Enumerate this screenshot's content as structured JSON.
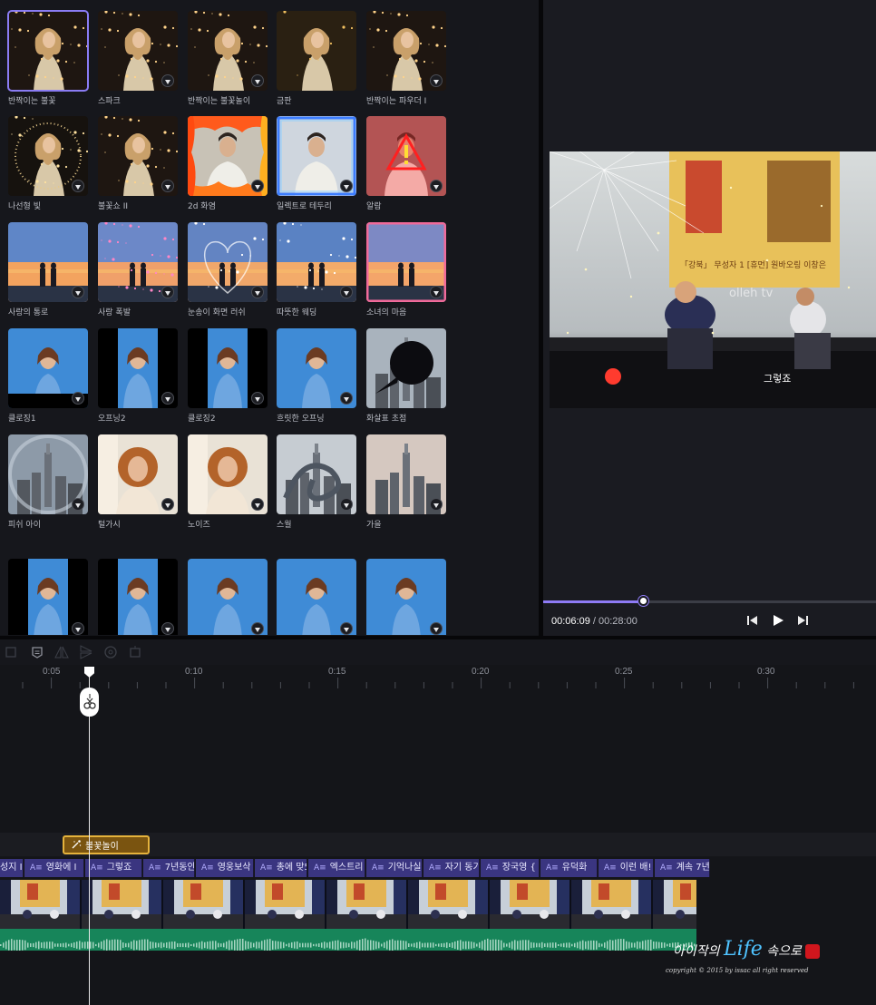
{
  "effects": {
    "rows": [
      [
        {
          "label": "반짝이는 불꽃",
          "selected": true,
          "download": false,
          "scene": "sparkle-woman"
        },
        {
          "label": "스파크",
          "download": true,
          "scene": "sparkle-woman"
        },
        {
          "label": "반짝이는 불꽃놀이",
          "download": true,
          "scene": "sparkle-woman"
        },
        {
          "label": "금판",
          "download": false,
          "scene": "gold-woman"
        },
        {
          "label": "반짝이는 파우더 I",
          "download": true,
          "scene": "sparkle-woman"
        }
      ],
      [
        {
          "label": "나선형 빛",
          "download": true,
          "scene": "spiral-woman"
        },
        {
          "label": "불꽃쇼 II",
          "download": true,
          "scene": "sparkle-woman"
        },
        {
          "label": "2d 화염",
          "download": true,
          "scene": "fire-man"
        },
        {
          "label": "일렉트로 테두리",
          "download": true,
          "scene": "electro-man"
        },
        {
          "label": "알람",
          "download": true,
          "scene": "alarm-man"
        }
      ],
      [
        {
          "label": "사랑의 통로",
          "download": true,
          "scene": "sunset-couple"
        },
        {
          "label": "사랑 폭발",
          "download": true,
          "scene": "hearts-couple"
        },
        {
          "label": "눈송이 화면 러쉬",
          "download": true,
          "scene": "snow-couple"
        },
        {
          "label": "따뜻한 웨딩",
          "download": true,
          "scene": "wedding-couple"
        },
        {
          "label": "소녀의 마음",
          "download": true,
          "scene": "pink-couple"
        }
      ],
      [
        {
          "label": "클로징1",
          "download": true,
          "scene": "blue-woman-wide"
        },
        {
          "label": "오프닝2",
          "download": true,
          "scene": "blue-woman-narrow"
        },
        {
          "label": "클로징2",
          "download": true,
          "scene": "blue-woman-narrow"
        },
        {
          "label": "흐릿한 오프닝",
          "download": true,
          "scene": "blue-woman-full"
        },
        {
          "label": "화살표 초점",
          "download": false,
          "scene": "arrow-city"
        }
      ],
      [
        {
          "label": "피쉬 아이",
          "download": true,
          "scene": "fisheye-city"
        },
        {
          "label": "털가시",
          "download": true,
          "scene": "curly-woman"
        },
        {
          "label": "노이즈",
          "download": true,
          "scene": "curly-woman"
        },
        {
          "label": "스월",
          "download": true,
          "scene": "swirl-city"
        },
        {
          "label": "가을",
          "download": true,
          "scene": "city"
        }
      ],
      [
        {
          "label": "",
          "download": true,
          "scene": "blue-woman-narrow"
        },
        {
          "label": "",
          "download": true,
          "scene": "blue-woman-narrow"
        },
        {
          "label": "",
          "download": true,
          "scene": "blue-woman-full"
        },
        {
          "label": "",
          "download": true,
          "scene": "blue-woman-full"
        },
        {
          "label": "",
          "download": true,
          "scene": "blue-woman-full"
        }
      ]
    ]
  },
  "preview": {
    "screen_banner": "「강북」 무성자 1 [휴먼] 원바오링 이창은",
    "screen_sub": "olleh tv",
    "caption": "그렇죠",
    "current_time": "00:06:09",
    "separator": " / ",
    "total_time": "00:28:00",
    "progress": 0.3
  },
  "playback": {
    "prev_icon": "skip-back-icon",
    "play_icon": "play-icon",
    "next_icon": "skip-forward-icon"
  },
  "toolbar": {
    "icons": [
      "split-icon",
      "caption-icon",
      "mirror-icon",
      "flip-icon",
      "speed-icon",
      "crop-icon"
    ]
  },
  "ruler": {
    "ticks": [
      "0:05",
      "0:10",
      "0:15",
      "0:20",
      "0:25",
      "0:30"
    ]
  },
  "timeline": {
    "effect_clip_label": "불꽃놀이",
    "text_clips": [
      "성지 I",
      "영화에 I",
      "그렇죠",
      "7년동안",
      "영웅보삭",
      "총에 맞5",
      "엑스트리",
      "기억나실",
      "자기 동기",
      "장국영 {",
      "유덕화",
      "이런 배!",
      "계속 7년"
    ]
  },
  "colors": {
    "accent": "#8e7bf5",
    "effect_clip": "#7a5410",
    "effect_clip_border": "#e4b23c",
    "text_clip": "#3a3580",
    "audio": "#17855a"
  },
  "watermark": {
    "title_pre": "아이작의 ",
    "title_big": "Life",
    "title_post": " 속으로",
    "copyright": "copyright © 2015 by issac all right reserved"
  }
}
